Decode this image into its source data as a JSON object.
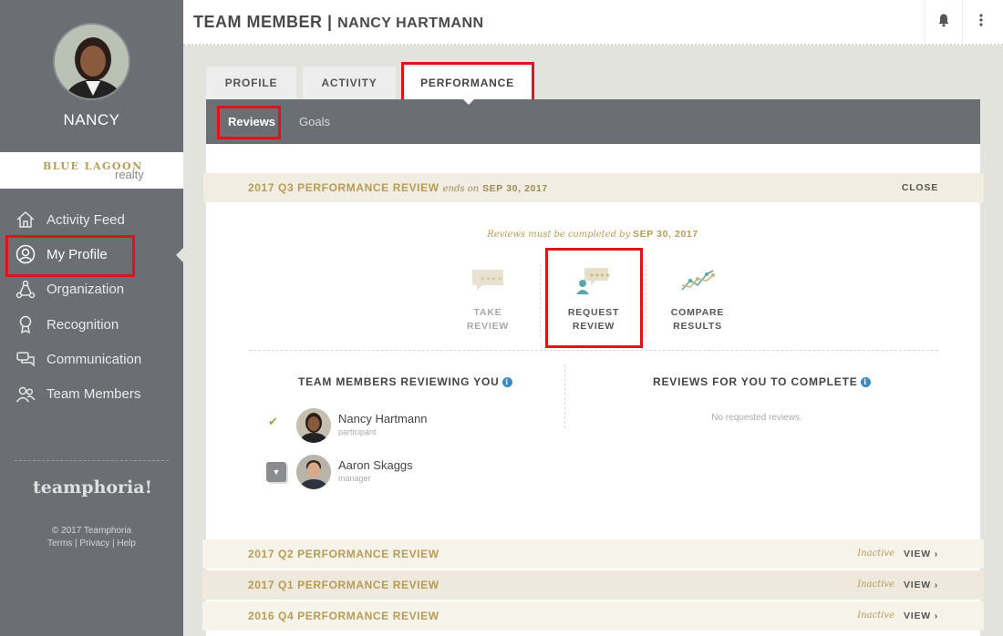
{
  "sidebar": {
    "user_name": "NANCY",
    "brand_primary": "BLUE LAGOON",
    "brand_secondary": "realty",
    "nav": [
      {
        "label": "Activity Feed",
        "icon": "home-icon"
      },
      {
        "label": "My Profile",
        "icon": "user-circle-icon",
        "active": true
      },
      {
        "label": "Organization",
        "icon": "org-chart-icon"
      },
      {
        "label": "Recognition",
        "icon": "ribbon-icon"
      },
      {
        "label": "Communication",
        "icon": "chat-bubbles-icon"
      },
      {
        "label": "Team Members",
        "icon": "people-icon"
      }
    ],
    "footer_logo": "teamphoria!",
    "copyright": "© 2017 Teamphoria",
    "footer_links": "Terms | Privacy | Help"
  },
  "header": {
    "title": "TEAM MEMBER",
    "separator": "|",
    "subtitle": "NANCY HARTMANN"
  },
  "tabs": [
    "PROFILE",
    "ACTIVITY",
    "PERFORMANCE"
  ],
  "active_tab": "PERFORMANCE",
  "subtabs": [
    "Reviews",
    "Goals"
  ],
  "active_subtab": "Reviews",
  "current_review": {
    "title": "2017 Q3 PERFORMANCE REVIEW",
    "ends_label": "ends on",
    "ends_date": "SEP 30, 2017",
    "close_label": "CLOSE",
    "due_text": "Reviews must be completed by",
    "due_date": "SEP 30, 2017",
    "actions": {
      "take": {
        "line1": "TAKE",
        "line2": "REVIEW"
      },
      "request": {
        "line1": "REQUEST",
        "line2": "REVIEW"
      },
      "compare": {
        "line1": "COMPARE",
        "line2": "RESULTS"
      }
    },
    "reviewing_you_title": "TEAM MEMBERS REVIEWING YOU",
    "reviewers": [
      {
        "name": "Nancy Hartmann",
        "role": "participant"
      },
      {
        "name": "Aaron Skaggs",
        "role": "manager"
      }
    ],
    "to_complete_title": "REVIEWS FOR YOU TO COMPLETE",
    "to_complete_empty": "No requested reviews."
  },
  "past_reviews": [
    {
      "title": "2017 Q2 PERFORMANCE REVIEW",
      "status": "Inactive",
      "action": "VIEW ›"
    },
    {
      "title": "2017 Q1 PERFORMANCE REVIEW",
      "status": "Inactive",
      "action": "VIEW ›"
    },
    {
      "title": "2016 Q4 PERFORMANCE REVIEW",
      "status": "Inactive",
      "action": "VIEW ›"
    }
  ],
  "colors": {
    "sidebar": "#6b6e72",
    "accent_gold": "#b69c54",
    "highlight_red": "#e0121a",
    "info_blue": "#3a8ac4",
    "check_green": "#7cb342"
  }
}
